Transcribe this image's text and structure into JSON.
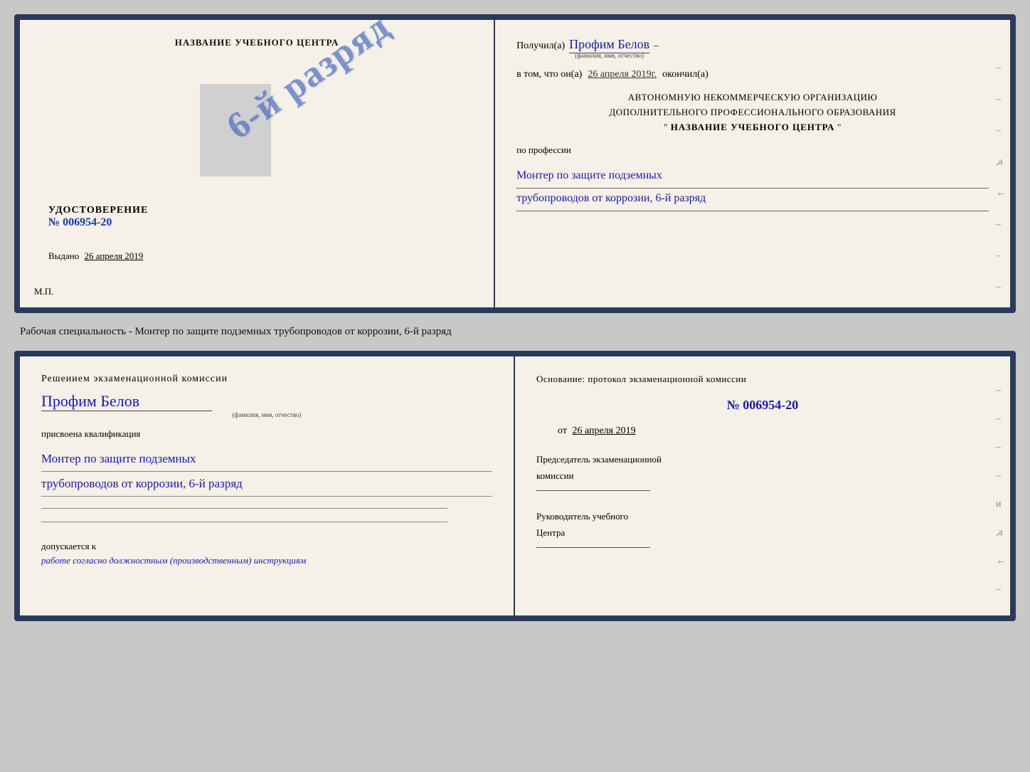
{
  "page": {
    "background": "#c8c8c8"
  },
  "diploma": {
    "left": {
      "center_title": "НАЗВАНИЕ УЧЕБНОГО ЦЕНТРА",
      "stamp_text": "6-й разряд",
      "udost_label": "УДОСТОВЕРЕНИЕ",
      "udost_number": "№ 006954-20",
      "vydano_label": "Выдано",
      "vydano_date": "26 апреля 2019",
      "mp_label": "М.П."
    },
    "right": {
      "poluchil_label": "Получил(а)",
      "poluchil_name": "Профим Белов",
      "fio_label": "(фамилия, имя, отчество)",
      "vtom_label": "в том, что он(а)",
      "vtom_date": "26 апреля 2019г.",
      "okonchil_label": "окончил(а)",
      "org_line1": "АВТОНОМНУЮ НЕКОММЕРЧЕСКУЮ ОРГАНИЗАЦИЮ",
      "org_line2": "ДОПОЛНИТЕЛЬНОГО ПРОФЕССИОНАЛЬНОГО ОБРАЗОВАНИЯ",
      "org_quote1": "\"",
      "org_name": "НАЗВАНИЕ УЧЕБНОГО ЦЕНТРА",
      "org_quote2": "\"",
      "po_professii": "по профессии",
      "profession_line1": "Монтер по защите подземных",
      "profession_line2": "трубопроводов от коррозии, 6-й разряд"
    }
  },
  "middle": {
    "text": "Рабочая специальность - Монтер по защите подземных трубопроводов от коррозии, 6-й разряд"
  },
  "bottom": {
    "left": {
      "resheniem_label": "Решением экзаменационной комиссии",
      "name": "Профим Белов",
      "fio_label": "(фамилия, имя, отчество)",
      "prisvoena_label": "присвоена квалификация",
      "kvalif_line1": "Монтер по защите подземных",
      "kvalif_line2": "трубопроводов от коррозии, 6-й разряд",
      "dopusk_label": "допускается к",
      "dopusk_text": "работе согласно должностным (производственным) инструкциям"
    },
    "right": {
      "osnovanie_label": "Основание: протокол экзаменационной комиссии",
      "protocol_number": "№ 006954-20",
      "protocol_ot": "от",
      "protocol_date": "26 апреля 2019",
      "predsedatel_line1": "Председатель экзаменационной",
      "predsedatel_line2": "комиссии",
      "rukovoditel_line1": "Руководитель учебного",
      "rukovoditel_line2": "Центра"
    }
  }
}
